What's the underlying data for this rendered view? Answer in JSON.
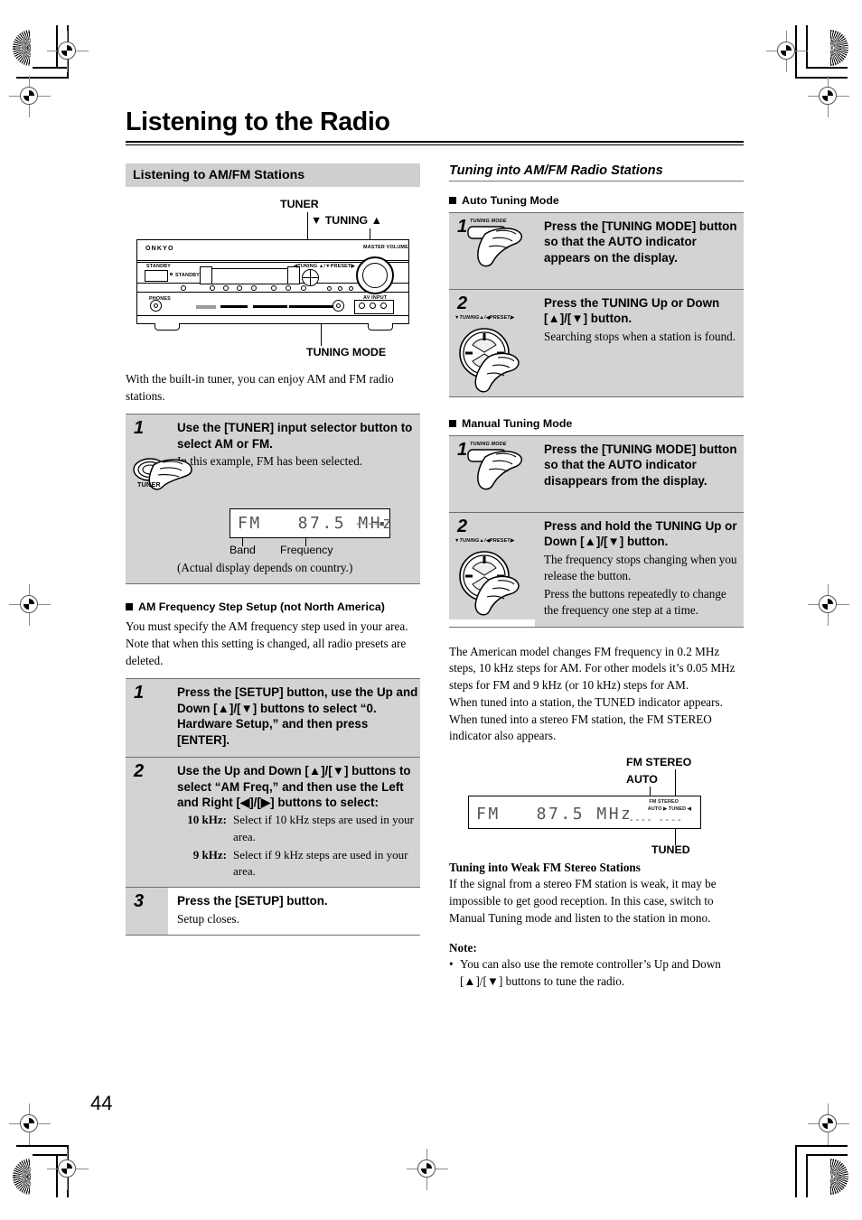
{
  "document": {
    "title": "Listening to the Radio",
    "page_number": "44"
  },
  "left_column": {
    "section_title": "Listening to AM/FM Stations",
    "figure": {
      "callouts": {
        "tuner": "TUNER",
        "tuning_updown": "▼ TUNING ▲",
        "tuning_mode": "TUNING MODE"
      },
      "brand": "ONKYO"
    },
    "intro": "With the built-in tuner, you can enjoy AM and FM radio stations.",
    "steps": [
      {
        "num": "1",
        "icon_label": "TUNER",
        "title": "Use the [TUNER] input selector button to select AM or FM.",
        "sub": "In this example, FM has been selected.",
        "display": {
          "text": "FM   87.5 MHz",
          "trailing": "----▪",
          "band_label": "Band",
          "frequency_label": "Frequency"
        },
        "footnote": "(Actual display depends on country.)"
      }
    ],
    "am_step_setup": {
      "heading": "AM Frequency Step Setup (not North America)",
      "body": "You must specify the AM frequency step used in your area. Note that when this setting is changed, all radio presets are deleted.",
      "steps": [
        {
          "num": "1",
          "title": "Press the [SETUP] button, use the Up and Down [▲]/[▼] buttons to select “0. Hardware Setup,” and then press [ENTER]."
        },
        {
          "num": "2",
          "title": "Use the Up and Down [▲]/[▼] buttons to select “AM Freq,” and then use the Left and Right [◀]/[▶] buttons to select:",
          "defs": [
            {
              "term": "10 kHz:",
              "desc": "Select if 10 kHz steps are used in your area."
            },
            {
              "term": "9 kHz:",
              "desc": "Select if 9 kHz steps are used in your area."
            }
          ]
        },
        {
          "num": "3",
          "title": "Press the [SETUP] button.",
          "sub": "Setup closes."
        }
      ]
    }
  },
  "right_column": {
    "section_title": "Tuning into AM/FM Radio Stations",
    "auto_tuning": {
      "heading": "Auto Tuning Mode",
      "steps": [
        {
          "num": "1",
          "icon_label": "TUNING MODE",
          "title": "Press the [TUNING MODE] button so that the AUTO indicator appears on the display."
        },
        {
          "num": "2",
          "icon_label": "▼TUNING▲/◀PRESET▶",
          "title": "Press the TUNING Up or Down [▲]/[▼] button.",
          "sub": "Searching stops when a station is found."
        }
      ]
    },
    "manual_tuning": {
      "heading": "Manual Tuning Mode",
      "steps": [
        {
          "num": "1",
          "icon_label": "TUNING MODE",
          "title": "Press the [TUNING MODE] button so that the AUTO indicator disappears from the display."
        },
        {
          "num": "2",
          "icon_label": "▼TUNING▲/◀PRESET▶",
          "title": "Press and hold the TUNING Up or Down [▲]/[▼] button.",
          "sub1": "The frequency stops changing when you release the button.",
          "sub2": "Press the buttons repeatedly to change the frequency one step at a time."
        }
      ]
    },
    "body_paragraphs": [
      "The American model changes FM frequency in 0.2 MHz steps, 10 kHz steps for AM. For other models it’s 0.05 MHz steps for FM and 9 kHz (or 10 kHz) steps for AM.",
      "When tuned into a station, the TUNED indicator appears. When tuned into a stereo FM station, the FM STEREO indicator also appears."
    ],
    "display_figure": {
      "text": "FM   87.5 MHz",
      "trailing": "---- ----",
      "indicator_fm_stereo": "FM STEREO",
      "indicator_auto_tuned": "AUTO ▶ TUNED ◀",
      "callouts": {
        "fm_stereo": "FM STEREO",
        "auto": "AUTO",
        "tuned": "TUNED"
      }
    },
    "weak_fm": {
      "heading": "Tuning into Weak FM Stereo Stations",
      "body": "If the signal from a stereo FM station is weak, it may be impossible to get good reception. In this case, switch to Manual Tuning mode and listen to the station in mono."
    },
    "note": {
      "heading": "Note:",
      "bullet": "You can also use the remote controller’s Up and Down [▲]/[▼] buttons to tune the radio."
    }
  }
}
